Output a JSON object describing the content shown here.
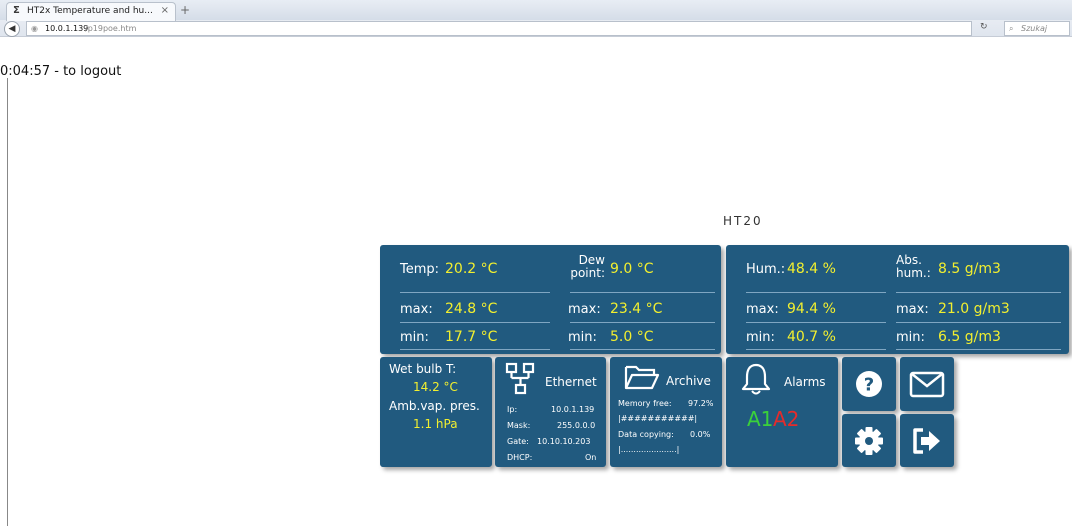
{
  "browser": {
    "tab_title": "HT2x Temperature and hu...",
    "tab_close": "×",
    "new_tab": "+",
    "url_host": "10.0.1.139",
    "url_path": "/p19poe.htm",
    "search_placeholder": "Szukaj"
  },
  "page": {
    "logout_timer": "0:04:57 - to logout",
    "device_name": "HT20"
  },
  "temp_panel": {
    "temp_label": "Temp:",
    "temp_value": "20.2 °C",
    "dew_label_1": "Dew",
    "dew_label_2": "point:",
    "dew_value": "9.0 °C",
    "max_label": "max:",
    "temp_max": "24.8 °C",
    "dew_max": "23.4 °C",
    "min_label": "min:",
    "temp_min": "17.7 °C",
    "dew_min": "5.0 °C"
  },
  "hum_panel": {
    "hum_label": "Hum.:",
    "hum_value": "48.4 %",
    "abs_label_1": "Abs.",
    "abs_label_2": "hum.:",
    "abs_value": "8.5 g/m3",
    "max_label": "max:",
    "hum_max": "94.4 %",
    "abs_max": "21.0 g/m3",
    "min_label": "min:",
    "hum_min": "40.7 %",
    "abs_min": "6.5 g/m3"
  },
  "wetbulb_panel": {
    "wet_label": "Wet bulb T:",
    "wet_value": "14.2 °C",
    "amb_label": "Amb.vap. pres.",
    "amb_value": "1.1 hPa"
  },
  "ethernet_panel": {
    "title": "Ethernet",
    "ip_label": "Ip:",
    "ip_value": "10.0.1.139",
    "mask_label": "Mask:",
    "mask_value": "255.0.0.0",
    "gate_label": "Gate:",
    "gate_value": "10.10.10.203",
    "dhcp_label": "DHCP:",
    "dhcp_value": "On"
  },
  "archive_panel": {
    "title": "Archive",
    "memory_label": "Memory free:",
    "memory_value": "97.2%",
    "memory_bar": "|###########|",
    "copy_label": "Data copying:",
    "copy_value": "0.0%",
    "copy_bar": "|......................|"
  },
  "alarms_panel": {
    "title": "Alarms",
    "a1": "A1",
    "a2": "A2",
    "a1_color": "#3ad13a",
    "a2_color": "#e52b2b"
  },
  "icons": {
    "help": "question-icon",
    "mail": "envelope-icon",
    "settings": "gear-icon",
    "logout": "logout-icon",
    "ethernet": "network-icon",
    "archive": "folder-icon",
    "alarms": "bell-icon"
  },
  "colors": {
    "panel": "#215a7f",
    "value": "#f2ef2f"
  }
}
